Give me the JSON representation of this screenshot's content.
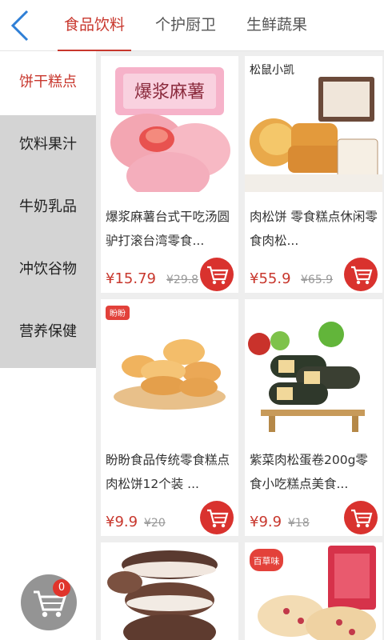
{
  "header": {
    "tabs": [
      {
        "label": "食品饮料",
        "active": true
      },
      {
        "label": "个护厨卫",
        "active": false
      },
      {
        "label": "生鲜蔬果",
        "active": false
      }
    ]
  },
  "sidebar": {
    "items": [
      {
        "label": "饼干糕点",
        "active": true
      },
      {
        "label": "饮料果汁",
        "active": false
      },
      {
        "label": "牛奶乳品",
        "active": false
      },
      {
        "label": "冲饮谷物",
        "active": false
      },
      {
        "label": "营养保健",
        "active": false
      }
    ]
  },
  "products": [
    {
      "title": "爆浆麻薯台式干吃汤圆驴打滚台湾零食...",
      "price": "¥15.79",
      "old_price": "¥29.8",
      "brand": "爆浆麻薯"
    },
    {
      "title": "肉松饼 零食糕点休闲零食肉松...",
      "price": "¥55.9",
      "old_price": "¥65.9",
      "brand": "松鼠小凯"
    },
    {
      "title": "盼盼食品传统零食糕点肉松饼12个装 ...",
      "price": "¥9.9",
      "old_price": "¥20",
      "brand": "盼盼"
    },
    {
      "title": "紫菜肉松蛋卷200g零食小吃糕点美食...",
      "price": "¥9.9",
      "old_price": "¥18",
      "brand": ""
    },
    {
      "title": "",
      "price": "",
      "old_price": "",
      "brand": ""
    },
    {
      "title": "",
      "price": "",
      "old_price": "",
      "brand": "百草味"
    }
  ],
  "cart": {
    "count": "0"
  },
  "colors": {
    "accent": "#c8372d",
    "cart_button": "#d9322e",
    "sidebar_grey": "#d4d4d4"
  },
  "icons": {
    "back": "chevron-left-icon",
    "cart": "shopping-cart-icon"
  }
}
